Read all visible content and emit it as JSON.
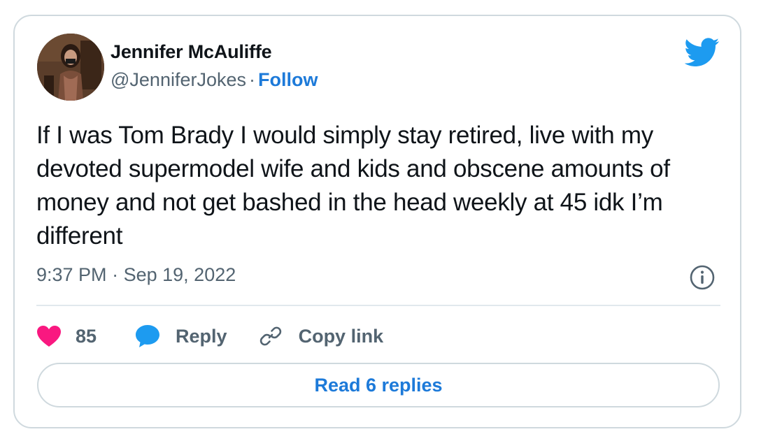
{
  "author": {
    "name": "Jennifer McAuliffe",
    "handle": "@JenniferJokes",
    "separator": "·",
    "follow_label": "Follow"
  },
  "tweet": {
    "text": "If I was Tom Brady I would simply stay retired, live with my devoted supermodel wife and kids and obscene amounts of money and not get bashed in the head weekly at 45 idk I’m different",
    "time": "9:37 PM",
    "separator": "·",
    "date": "Sep 19, 2022"
  },
  "actions": {
    "like_count": "85",
    "reply_label": "Reply",
    "copy_link_label": "Copy link",
    "read_replies_label": "Read 6 replies"
  },
  "icons": {
    "brand": "twitter-bird-icon",
    "info": "info-icon",
    "like": "heart-icon",
    "reply": "speech-bubble-icon",
    "copy": "link-icon"
  },
  "colors": {
    "brand_blue": "#1d9bf0",
    "link_blue": "#1d7ad9",
    "like_pink": "#f91880",
    "text_primary": "#0f1419",
    "text_secondary": "#536471",
    "border": "#cfd9de"
  }
}
